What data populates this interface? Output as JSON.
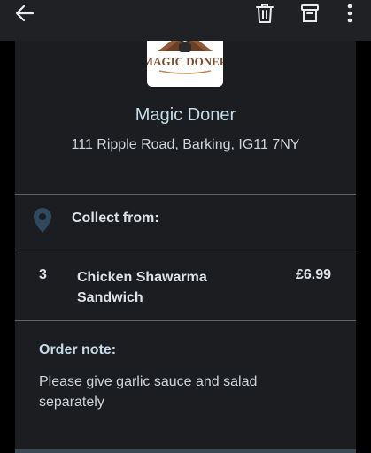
{
  "toolbar": {
    "back_icon": "arrow-left-icon",
    "delete_icon": "trash-icon",
    "archive_icon": "archive-icon",
    "more_icon": "more-vertical-icon"
  },
  "restaurant": {
    "logo_text": "MAGIC DONER",
    "name": "Magic Doner",
    "address": "111 Ripple Road, Barking, IG11 7NY"
  },
  "collect": {
    "icon": "location-pin-icon",
    "label": "Collect from:"
  },
  "order_items": [
    {
      "quantity": "3",
      "name": "Chicken Shawarma Sandwich",
      "price": "£6.99"
    }
  ],
  "order_note": {
    "title": "Order note:",
    "text": "Please give garlic sauce and salad separately"
  },
  "colors": {
    "appbar": "#202124",
    "card": "#1b1d21",
    "heading": "#c6dce9",
    "text": "#dfe3e8",
    "pin": "#2f4a5e"
  }
}
